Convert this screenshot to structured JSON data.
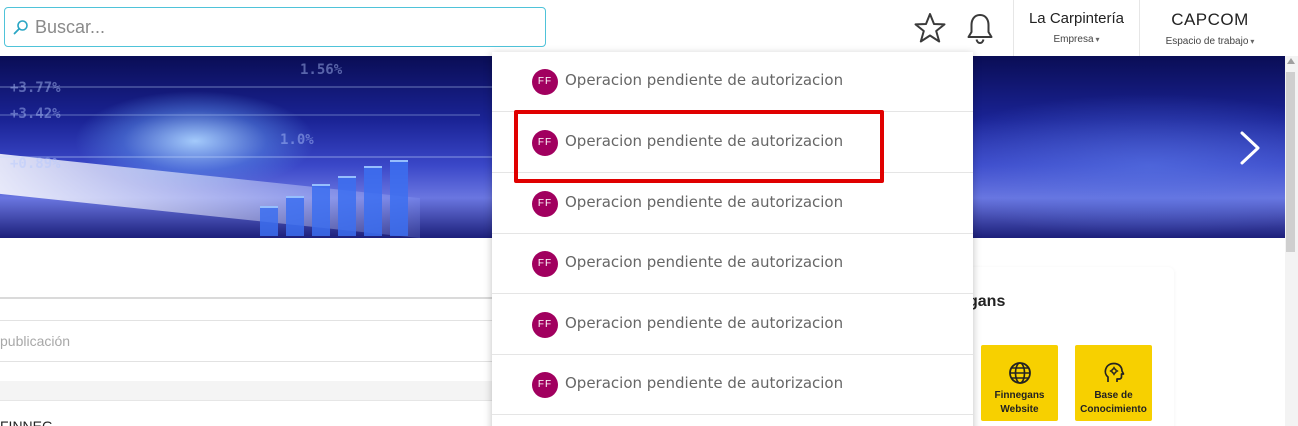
{
  "search": {
    "placeholder": "Buscar..."
  },
  "header": {
    "icons": [
      "star-icon",
      "bell-icon"
    ],
    "company": {
      "name": "La Carpintería",
      "label": "Empresa"
    },
    "workspace": {
      "name": "CAPCOM",
      "label": "Espacio de trabajo"
    }
  },
  "main": {
    "publication_placeholder": "publicación",
    "bottom_text": "FINNEG"
  },
  "side_panel": {
    "title": "gans",
    "tiles": [
      {
        "label": "Finnegans Website",
        "icon": "globe-icon"
      },
      {
        "label": "Base de Conocimiento",
        "icon": "head-gear-icon"
      }
    ]
  },
  "notifications": {
    "items": [
      {
        "avatar": "FF",
        "text": "Operacion pendiente de autorizacion"
      },
      {
        "avatar": "FF",
        "text": "Operacion pendiente de autorizacion"
      },
      {
        "avatar": "FF",
        "text": "Operacion pendiente de autorizacion"
      },
      {
        "avatar": "FF",
        "text": "Operacion pendiente de autorizacion"
      },
      {
        "avatar": "FF",
        "text": "Operacion pendiente de autorizacion"
      },
      {
        "avatar": "FF",
        "text": "Operacion pendiente de autorizacion"
      }
    ],
    "highlighted_index": 1
  },
  "colors": {
    "search_border": "#4fc3d9",
    "avatar": "#a1005f",
    "tile": "#f7d000",
    "highlight": "#e00000"
  }
}
